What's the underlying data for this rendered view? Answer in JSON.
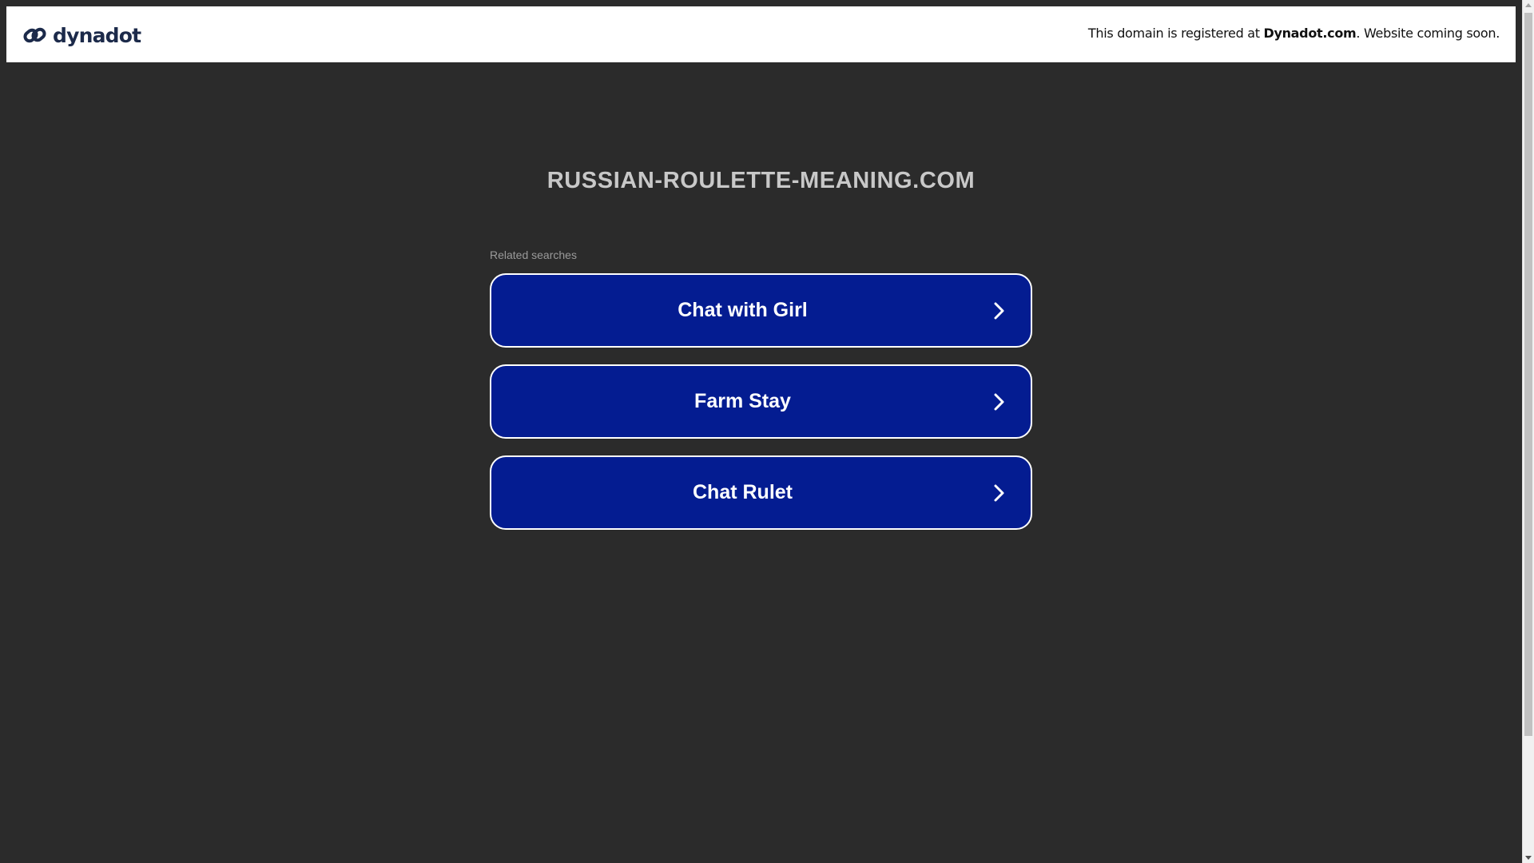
{
  "header": {
    "logo_text": "dynadot",
    "logo_icon": "dynadot-link-icon",
    "registered_prefix": "This domain is registered at ",
    "registered_brand": "Dynadot.com",
    "registered_suffix": ". Website coming soon."
  },
  "main": {
    "domain": "RUSSIAN-ROULETTE-MEANING.COM",
    "related_label": "Related searches",
    "searches": [
      {
        "label": "Chat with Girl",
        "icon": "chevron-right-icon"
      },
      {
        "label": "Farm Stay",
        "icon": "chevron-right-icon"
      },
      {
        "label": "Chat Rulet",
        "icon": "chevron-right-icon"
      }
    ]
  },
  "colors": {
    "background": "#2b2b2b",
    "button_bg": "#041c91",
    "button_border": "#ffffff",
    "title_text": "#c8c8c8"
  }
}
